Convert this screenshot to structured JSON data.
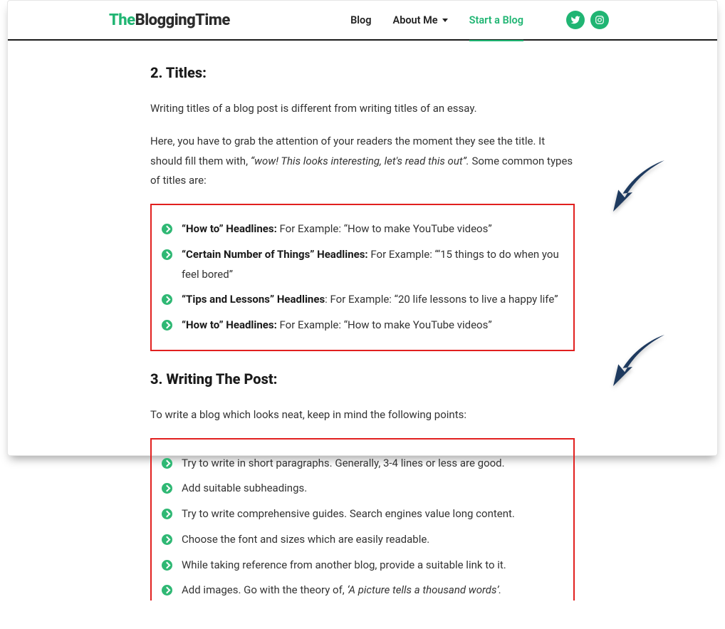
{
  "header": {
    "logo_part1": "The",
    "logo_part2": "BloggingTime",
    "nav": {
      "blog": "Blog",
      "about": "About Me",
      "start": "Start a Blog"
    }
  },
  "section1": {
    "heading": "2. Titles:",
    "p1": "Writing titles of a blog post is different from writing titles of an essay.",
    "p2a": "Here, you have to grab the attention of your readers the moment they see the title. It should fill them with, ",
    "p2b": "“wow! This looks interesting, let's read this out”.",
    "p2c": " Some common types of titles are:",
    "bullets": [
      {
        "bold": "“How to” Headlines: ",
        "rest": "For Example: “How to make YouTube videos”"
      },
      {
        "bold": "“Certain Number of Things” Headlines: ",
        "rest": "For Example: “‘15 things to do when you feel bored”"
      },
      {
        "bold": "“Tips and Lessons” Headlines",
        "rest": ": For Example: “20 life lessons to live a happy life”"
      },
      {
        "bold": "“How to” Headlines: ",
        "rest": "For Example: “How to make YouTube videos”"
      }
    ]
  },
  "section2": {
    "heading": "3. Writing The Post:",
    "p1": "To write a blog which looks neat, keep in mind the following points:",
    "bullets": [
      "Try to write in short paragraphs. Generally, 3-4 lines or less are good.",
      "Add suitable subheadings.",
      "Try to write comprehensive guides. Search engines value long content.",
      "Choose the font and sizes which are easily readable.",
      "While taking reference from another blog, provide a suitable link to it."
    ],
    "last_a": "Add images. Go with the theory of, ",
    "last_b": "‘A picture tells a thousand words’."
  }
}
